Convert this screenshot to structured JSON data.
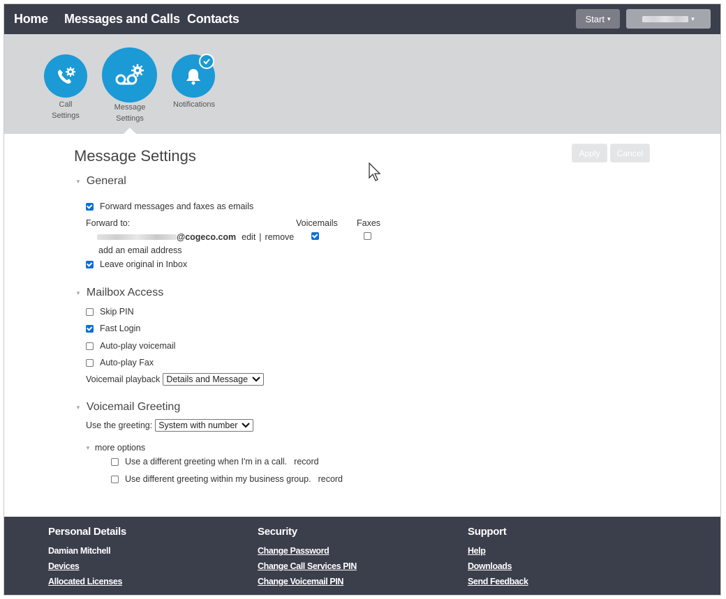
{
  "nav": {
    "links": [
      "Home",
      "Messages and Calls",
      "Contacts"
    ],
    "start_label": "Start"
  },
  "settings_icons": [
    {
      "label_line1": "Call",
      "label_line2": "Settings",
      "icon": "phone-gear-icon"
    },
    {
      "label_line1": "Message",
      "label_line2": "Settings",
      "icon": "voicemail-gear-icon"
    },
    {
      "label_line1": "Notifications",
      "label_line2": "",
      "icon": "bell-icon"
    }
  ],
  "page": {
    "title": "Message Settings",
    "apply_label": "Apply",
    "cancel_label": "Cancel"
  },
  "general": {
    "heading": "General",
    "forward_label": "Forward messages and faxes as emails",
    "forward_checked": true,
    "forward_to_label": "Forward to:",
    "col_voicemails": "Voicemails",
    "col_faxes": "Faxes",
    "email_domain": "@cogeco.com",
    "edit_label": "edit",
    "separator": "|",
    "remove_label": "remove",
    "voicemails_checked": true,
    "faxes_checked": false,
    "add_email_label": "add an email address",
    "leave_original_label": "Leave original in Inbox",
    "leave_original_checked": true
  },
  "mailbox": {
    "heading": "Mailbox Access",
    "skip_pin": "Skip PIN",
    "fast_login": "Fast Login",
    "autoplay_voicemail": "Auto-play voicemail",
    "autoplay_fax": "Auto-play Fax",
    "playback_label": "Voicemail playback",
    "playback_value": "Details and Message"
  },
  "greeting": {
    "heading": "Voicemail Greeting",
    "use_label": "Use the greeting:",
    "use_value": "System with number",
    "more_options": "more options",
    "option_in_call": "Use a different greeting when I'm in a call.",
    "option_business": "Use different greeting within my business group.",
    "record_label": "record"
  },
  "footer": {
    "personal": {
      "heading": "Personal Details",
      "name": "Damian Mitchell",
      "devices": "Devices",
      "licenses": "Allocated Licenses"
    },
    "security": {
      "heading": "Security",
      "password": "Change Password",
      "call_pin": "Change Call Services PIN",
      "voicemail_pin": "Change Voicemail PIN"
    },
    "support": {
      "heading": "Support",
      "help": "Help",
      "downloads": "Downloads",
      "feedback": "Send Feedback"
    }
  },
  "colors": {
    "nav_bg": "#3b3f4c",
    "band_bg": "#d5d6d8",
    "accent_blue": "#1b9ad6",
    "checkbox_blue": "#0b6fd6"
  }
}
